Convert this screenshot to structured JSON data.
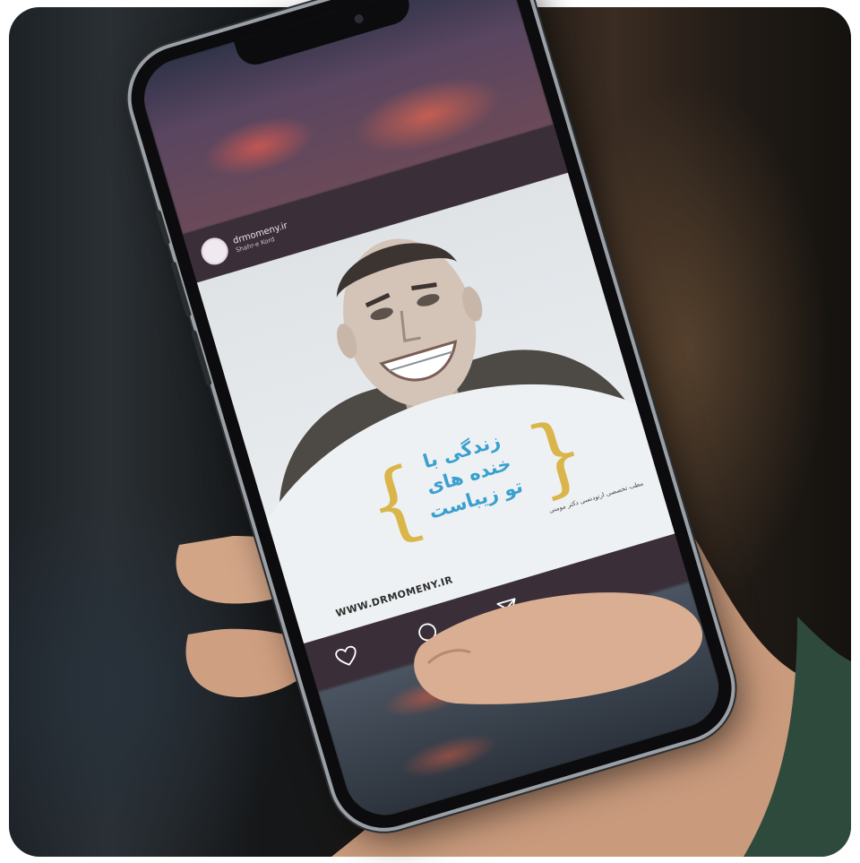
{
  "instagram_post": {
    "username": "drmomeny.ir",
    "location": "Shahr-e Kord",
    "slogan_line1": "زندگی با",
    "slogan_line2": "خنده های",
    "slogan_line3": "تو زیباست",
    "clinic_line": "مطب تخصصی ارتودنسی دکتر مومنی",
    "website": "WWW.DRMOMENY.IR"
  },
  "icons": {
    "like": "heart-icon",
    "comment": "comment-icon",
    "share": "send-icon"
  },
  "colors": {
    "accent_blue": "#3aa0cf",
    "brace_gold": "#d9b54a",
    "bar_dark": "#3a2f38"
  }
}
